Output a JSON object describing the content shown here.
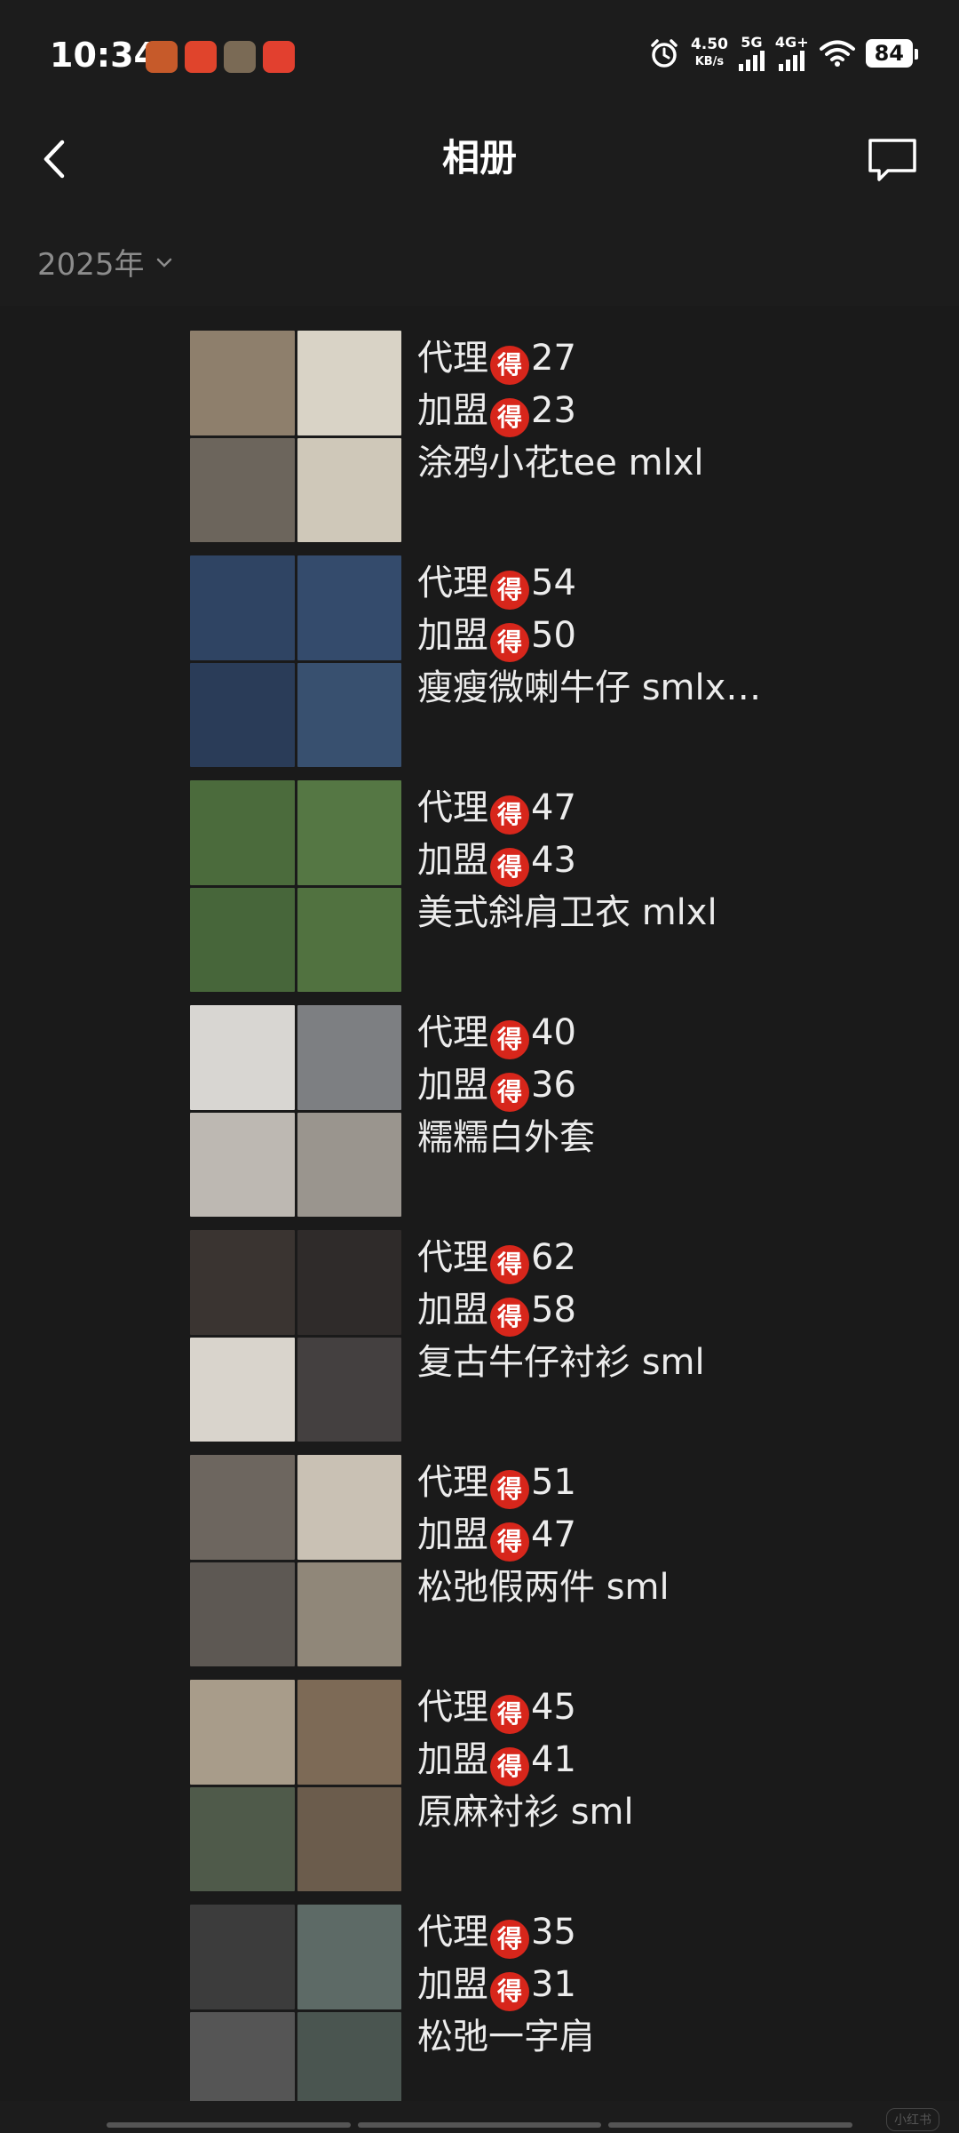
{
  "status": {
    "time": "10:34",
    "net_speed_value": "4.50",
    "net_speed_unit": "KB/s",
    "net1": "5G",
    "net2": "4G+",
    "battery": "84",
    "app_icon_colors": [
      "#c65a2a",
      "#e0442c",
      "#7a6a55",
      "#e2402f"
    ]
  },
  "nav": {
    "title": "相册"
  },
  "filter": {
    "year_label": "2025年"
  },
  "labels": {
    "agent": "代理",
    "franchise": "加盟",
    "badge": "得"
  },
  "items": [
    {
      "agent_price": "27",
      "franchise_price": "23",
      "desc": "涂鸦小花tee mlxl",
      "colors": [
        "#8e7f6c",
        "#d9d3c6",
        "#6c655c",
        "#cfc8b9"
      ]
    },
    {
      "agent_price": "54",
      "franchise_price": "50",
      "desc": "瘦瘦微喇牛仔 smlx…",
      "colors": [
        "#2f4463",
        "#344b6c",
        "#2a3c58",
        "#38506f"
      ]
    },
    {
      "agent_price": "47",
      "franchise_price": "43",
      "desc": "美式斜肩卫衣 mlxl",
      "colors": [
        "#4b6b3c",
        "#557744",
        "#47663a",
        "#517240"
      ]
    },
    {
      "agent_price": "40",
      "franchise_price": "36",
      "desc": "糯糯白外套",
      "colors": [
        "#d8d6d2",
        "#7d7f82",
        "#bdb8b2",
        "#9a958e"
      ]
    },
    {
      "agent_price": "62",
      "franchise_price": "58",
      "desc": "复古牛仔衬衫 sml",
      "colors": [
        "#3a3431",
        "#2f2b2a",
        "#d9d4cc",
        "#444040"
      ]
    },
    {
      "agent_price": "51",
      "franchise_price": "47",
      "desc": "松弛假两件 sml",
      "colors": [
        "#6d665f",
        "#c9c1b4",
        "#5d5853",
        "#908779"
      ]
    },
    {
      "agent_price": "45",
      "franchise_price": "41",
      "desc": "原麻衬衫 sml",
      "colors": [
        "#a89c8a",
        "#7d6a56",
        "#4f5a4a",
        "#6b5c4c"
      ]
    },
    {
      "agent_price": "35",
      "franchise_price": "31",
      "desc": "松弛一字肩",
      "colors": [
        "#3c3c3c",
        "#5d6a66",
        "#555555",
        "#4a5550"
      ]
    }
  ],
  "watermark": "小红书"
}
